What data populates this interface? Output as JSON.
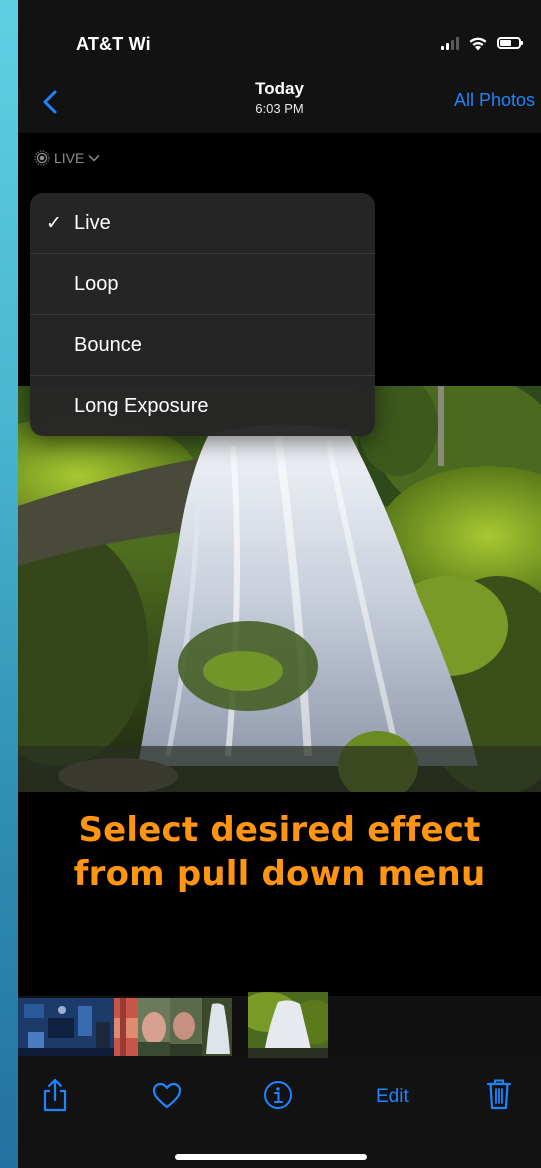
{
  "status": {
    "carrier": "AT&T Wi",
    "icons": [
      "signal-icon",
      "wifi-icon",
      "battery-icon"
    ]
  },
  "nav": {
    "title": "Today",
    "subtitle": "6:03 PM",
    "right_link": "All Photos",
    "back_icon": "chevron-left-icon"
  },
  "live_selector": {
    "label": "LIVE",
    "icon": "live-photo-icon"
  },
  "menu": {
    "items": [
      {
        "label": "Live",
        "checked": true
      },
      {
        "label": "Loop",
        "checked": false
      },
      {
        "label": "Bounce",
        "checked": false
      },
      {
        "label": "Long Exposure",
        "checked": false
      }
    ],
    "check_mark": "✓"
  },
  "caption": {
    "line1": "Select desired effect",
    "line2": "from pull down menu"
  },
  "toolbar": {
    "edit_label": "Edit",
    "icons": [
      "share-icon",
      "heart-icon",
      "info-icon",
      "trash-icon"
    ]
  },
  "colors": {
    "accent": "#1f84ff",
    "caption": "#ff9512",
    "background": "#000000"
  }
}
